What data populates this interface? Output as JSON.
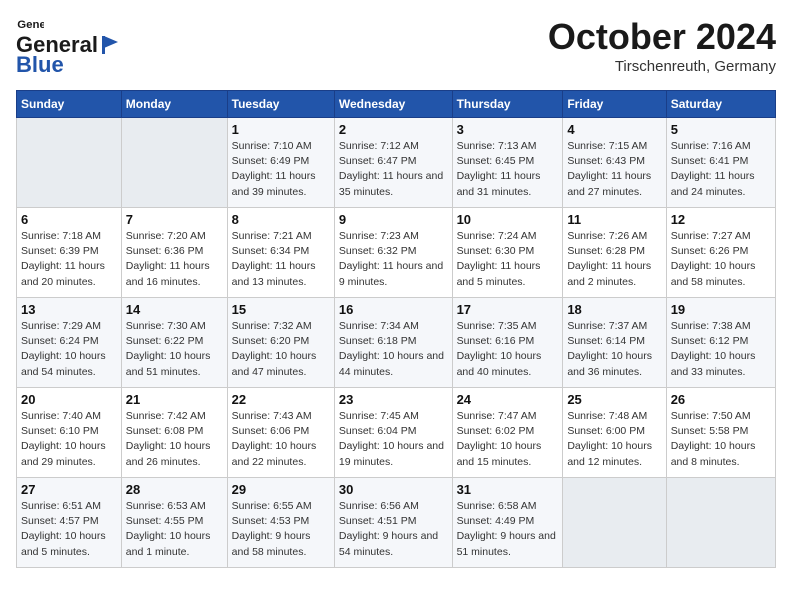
{
  "logo": {
    "line1": "General",
    "line2": "Blue"
  },
  "title": "October 2024",
  "subtitle": "Tirschenreuth, Germany",
  "days_of_week": [
    "Sunday",
    "Monday",
    "Tuesday",
    "Wednesday",
    "Thursday",
    "Friday",
    "Saturday"
  ],
  "weeks": [
    [
      {
        "day": "",
        "info": ""
      },
      {
        "day": "",
        "info": ""
      },
      {
        "day": "1",
        "info": "Sunrise: 7:10 AM\nSunset: 6:49 PM\nDaylight: 11 hours and 39 minutes."
      },
      {
        "day": "2",
        "info": "Sunrise: 7:12 AM\nSunset: 6:47 PM\nDaylight: 11 hours and 35 minutes."
      },
      {
        "day": "3",
        "info": "Sunrise: 7:13 AM\nSunset: 6:45 PM\nDaylight: 11 hours and 31 minutes."
      },
      {
        "day": "4",
        "info": "Sunrise: 7:15 AM\nSunset: 6:43 PM\nDaylight: 11 hours and 27 minutes."
      },
      {
        "day": "5",
        "info": "Sunrise: 7:16 AM\nSunset: 6:41 PM\nDaylight: 11 hours and 24 minutes."
      }
    ],
    [
      {
        "day": "6",
        "info": "Sunrise: 7:18 AM\nSunset: 6:39 PM\nDaylight: 11 hours and 20 minutes."
      },
      {
        "day": "7",
        "info": "Sunrise: 7:20 AM\nSunset: 6:36 PM\nDaylight: 11 hours and 16 minutes."
      },
      {
        "day": "8",
        "info": "Sunrise: 7:21 AM\nSunset: 6:34 PM\nDaylight: 11 hours and 13 minutes."
      },
      {
        "day": "9",
        "info": "Sunrise: 7:23 AM\nSunset: 6:32 PM\nDaylight: 11 hours and 9 minutes."
      },
      {
        "day": "10",
        "info": "Sunrise: 7:24 AM\nSunset: 6:30 PM\nDaylight: 11 hours and 5 minutes."
      },
      {
        "day": "11",
        "info": "Sunrise: 7:26 AM\nSunset: 6:28 PM\nDaylight: 11 hours and 2 minutes."
      },
      {
        "day": "12",
        "info": "Sunrise: 7:27 AM\nSunset: 6:26 PM\nDaylight: 10 hours and 58 minutes."
      }
    ],
    [
      {
        "day": "13",
        "info": "Sunrise: 7:29 AM\nSunset: 6:24 PM\nDaylight: 10 hours and 54 minutes."
      },
      {
        "day": "14",
        "info": "Sunrise: 7:30 AM\nSunset: 6:22 PM\nDaylight: 10 hours and 51 minutes."
      },
      {
        "day": "15",
        "info": "Sunrise: 7:32 AM\nSunset: 6:20 PM\nDaylight: 10 hours and 47 minutes."
      },
      {
        "day": "16",
        "info": "Sunrise: 7:34 AM\nSunset: 6:18 PM\nDaylight: 10 hours and 44 minutes."
      },
      {
        "day": "17",
        "info": "Sunrise: 7:35 AM\nSunset: 6:16 PM\nDaylight: 10 hours and 40 minutes."
      },
      {
        "day": "18",
        "info": "Sunrise: 7:37 AM\nSunset: 6:14 PM\nDaylight: 10 hours and 36 minutes."
      },
      {
        "day": "19",
        "info": "Sunrise: 7:38 AM\nSunset: 6:12 PM\nDaylight: 10 hours and 33 minutes."
      }
    ],
    [
      {
        "day": "20",
        "info": "Sunrise: 7:40 AM\nSunset: 6:10 PM\nDaylight: 10 hours and 29 minutes."
      },
      {
        "day": "21",
        "info": "Sunrise: 7:42 AM\nSunset: 6:08 PM\nDaylight: 10 hours and 26 minutes."
      },
      {
        "day": "22",
        "info": "Sunrise: 7:43 AM\nSunset: 6:06 PM\nDaylight: 10 hours and 22 minutes."
      },
      {
        "day": "23",
        "info": "Sunrise: 7:45 AM\nSunset: 6:04 PM\nDaylight: 10 hours and 19 minutes."
      },
      {
        "day": "24",
        "info": "Sunrise: 7:47 AM\nSunset: 6:02 PM\nDaylight: 10 hours and 15 minutes."
      },
      {
        "day": "25",
        "info": "Sunrise: 7:48 AM\nSunset: 6:00 PM\nDaylight: 10 hours and 12 minutes."
      },
      {
        "day": "26",
        "info": "Sunrise: 7:50 AM\nSunset: 5:58 PM\nDaylight: 10 hours and 8 minutes."
      }
    ],
    [
      {
        "day": "27",
        "info": "Sunrise: 6:51 AM\nSunset: 4:57 PM\nDaylight: 10 hours and 5 minutes."
      },
      {
        "day": "28",
        "info": "Sunrise: 6:53 AM\nSunset: 4:55 PM\nDaylight: 10 hours and 1 minute."
      },
      {
        "day": "29",
        "info": "Sunrise: 6:55 AM\nSunset: 4:53 PM\nDaylight: 9 hours and 58 minutes."
      },
      {
        "day": "30",
        "info": "Sunrise: 6:56 AM\nSunset: 4:51 PM\nDaylight: 9 hours and 54 minutes."
      },
      {
        "day": "31",
        "info": "Sunrise: 6:58 AM\nSunset: 4:49 PM\nDaylight: 9 hours and 51 minutes."
      },
      {
        "day": "",
        "info": ""
      },
      {
        "day": "",
        "info": ""
      }
    ]
  ]
}
